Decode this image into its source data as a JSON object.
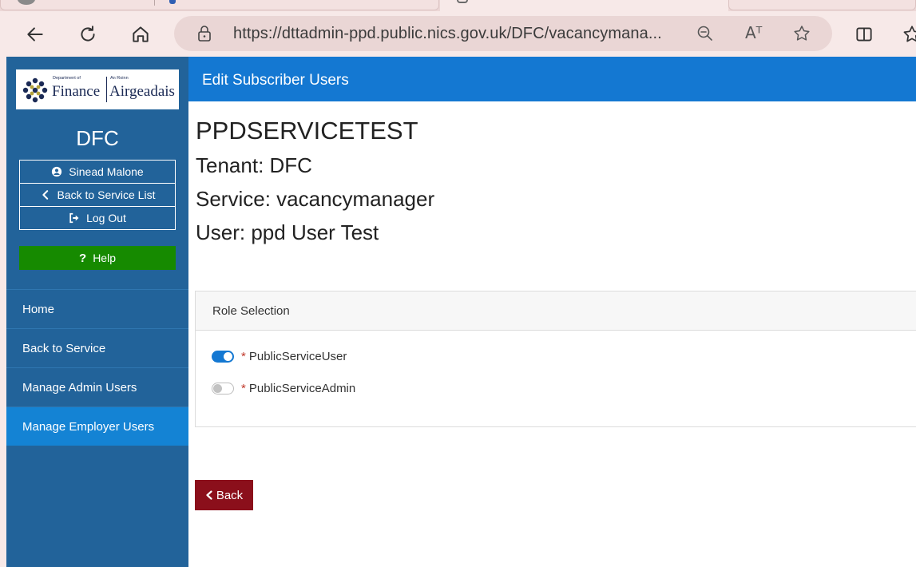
{
  "browser": {
    "url": "https://dttadmin-ppd.public.nics.gov.uk/DFC/vacancymana...",
    "read_aloud_glyph": "Aᵀ"
  },
  "sidebar": {
    "logo": {
      "small_left": "Department of",
      "text_left": "Finance",
      "small_right": "An Roinn",
      "text_right": "Airgeadais"
    },
    "dept": "DFC",
    "user_links": [
      {
        "label": "Sinead Malone",
        "icon": "user-circle-icon"
      },
      {
        "label": "Back to Service List",
        "icon": "chevron-left-icon"
      },
      {
        "label": "Log Out",
        "icon": "sign-out-icon"
      }
    ],
    "help": {
      "label": "Help",
      "glyph": "?"
    },
    "menu": [
      {
        "label": "Home",
        "active": false
      },
      {
        "label": "Back to Service",
        "active": false
      },
      {
        "label": "Manage Admin Users",
        "active": false
      },
      {
        "label": "Manage Employer Users",
        "active": true
      }
    ]
  },
  "header": {
    "title": "Edit Subscriber Users"
  },
  "main": {
    "service_title": "PPDSERVICETEST",
    "tenant": "Tenant: DFC",
    "service": "Service: vacancymanager",
    "user": "User: ppd User Test",
    "role_card": {
      "title": "Role Selection",
      "roles": [
        {
          "required_mark": "*",
          "label": "PublicServiceUser",
          "enabled": true
        },
        {
          "required_mark": "*",
          "label": "PublicServiceAdmin",
          "enabled": false
        }
      ]
    },
    "back_label": "Back"
  },
  "colors": {
    "sidebar": "#22639a",
    "header": "#1478d2",
    "active_menu": "#1483d4",
    "help": "#168a00",
    "back": "#8b0f1b"
  }
}
